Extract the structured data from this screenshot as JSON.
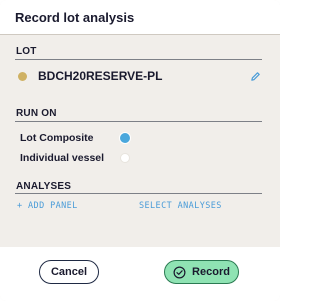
{
  "dialog": {
    "title": "Record lot analysis"
  },
  "lot": {
    "section_label": "LOT",
    "name": "BDCH20RESERVE-PL",
    "dot_color": "#cfb163",
    "edit_icon": "pencil-icon"
  },
  "run_on": {
    "section_label": "RUN ON",
    "options": [
      {
        "label": "Lot Composite",
        "selected": true
      },
      {
        "label": "Individual vessel",
        "selected": false
      }
    ]
  },
  "analyses": {
    "section_label": "ANALYSES",
    "add_panel": "+ ADD PANEL",
    "select_analyses": "SELECT ANALYSES"
  },
  "footer": {
    "cancel_label": "Cancel",
    "record_label": "Record",
    "record_icon": "check-circle-icon"
  },
  "colors": {
    "accent_blue": "#4aa7dc",
    "record_green": "#8fe3b3",
    "navy": "#1f2a44"
  }
}
